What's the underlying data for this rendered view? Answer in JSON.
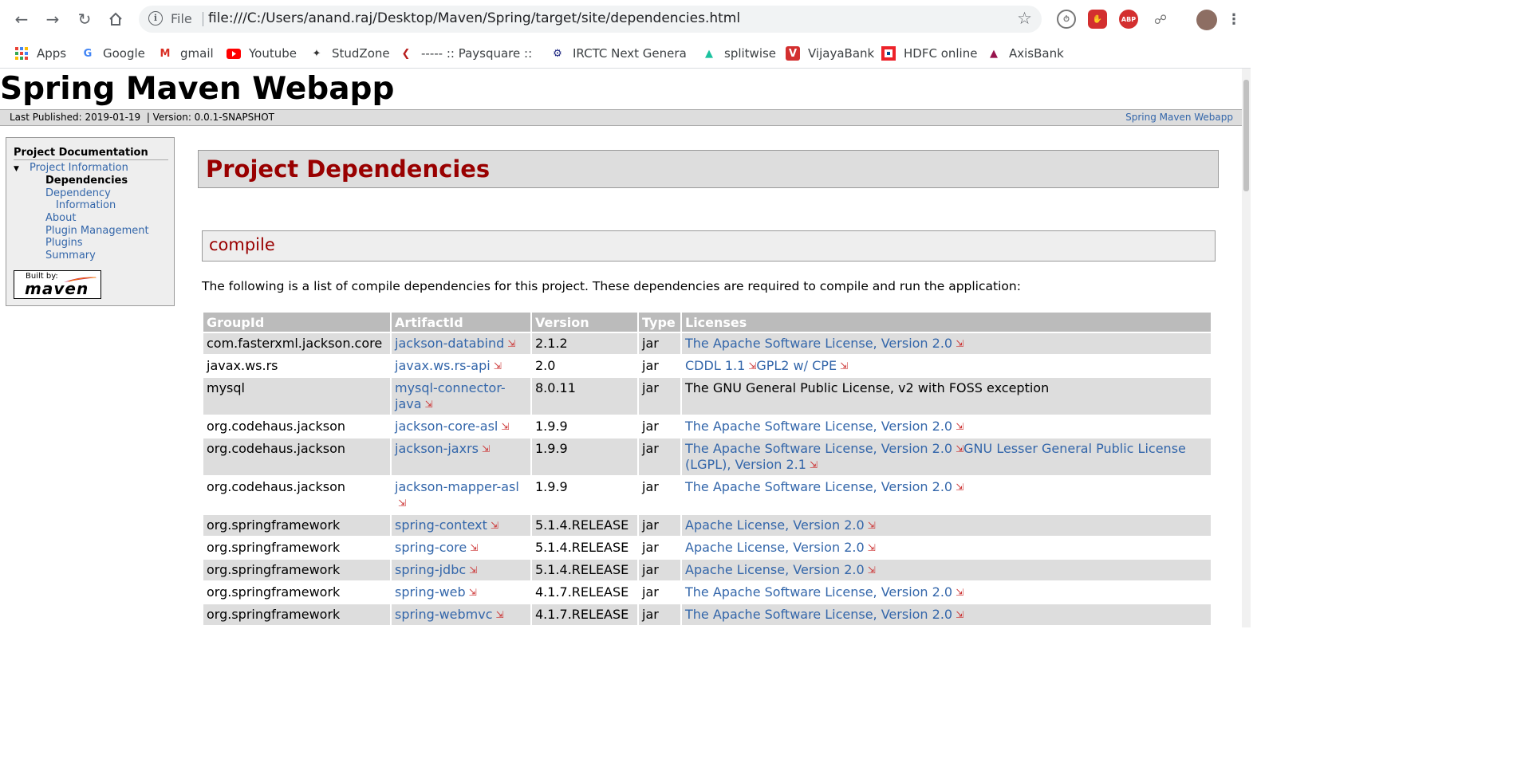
{
  "browser": {
    "url_scheme": "File",
    "url": "file:///C:/Users/anand.raj/Desktop/Maven/Spring/target/site/dependencies.html",
    "bookmarks": [
      {
        "label": "Apps",
        "icon": "apps-grid-icon",
        "color": "#ea4335"
      },
      {
        "label": "Google",
        "icon": "google-icon",
        "color": "#4285f4"
      },
      {
        "label": "gmail",
        "icon": "gmail-icon",
        "color": "#d93025"
      },
      {
        "label": "Youtube",
        "icon": "youtube-icon",
        "color": "#ff0000"
      },
      {
        "label": "StudZone",
        "icon": "studzone-icon",
        "color": "#333333"
      },
      {
        "label": "----- :: Paysquare :: --",
        "icon": "paysquare-icon",
        "color": "#b71c1c"
      },
      {
        "label": "IRCTC Next Generatio",
        "icon": "irctc-icon",
        "color": "#1a237e"
      },
      {
        "label": "splitwise",
        "icon": "splitwise-icon",
        "color": "#1cc29f"
      },
      {
        "label": "VijayaBank",
        "icon": "vijayabank-icon",
        "color": "#d32f2f"
      },
      {
        "label": "HDFC online",
        "icon": "hdfc-icon",
        "color": "#004c8f"
      },
      {
        "label": "AxisBank",
        "icon": "axisbank-icon",
        "color": "#97144d"
      }
    ]
  },
  "site": {
    "title": "Spring Maven Webapp",
    "last_published": "Last Published: 2019-01-19",
    "version": "| Version: 0.0.1-SNAPSHOT",
    "right_link": "Spring Maven Webapp"
  },
  "nav": {
    "header": "Project Documentation",
    "section": "Project Information",
    "current": "Dependencies",
    "items": [
      "Dependency",
      "Information",
      "About",
      "Plugin Management",
      "Plugins",
      "Summary"
    ],
    "built_by_small": "Built by:",
    "built_by_big": "maven"
  },
  "main": {
    "title": "Project Dependencies",
    "scope": "compile",
    "description": "The following is a list of compile dependencies for this project. These dependencies are required to compile and run the application:",
    "columns": [
      "GroupId",
      "ArtifactId",
      "Version",
      "Type",
      "Licenses"
    ],
    "rows": [
      {
        "group": "com.fasterxml.jackson.core",
        "artifact": "jackson-databind",
        "version": "2.1.2",
        "type": "jar",
        "licenses": [
          {
            "text": "The Apache Software License, Version 2.0",
            "link": true
          }
        ]
      },
      {
        "group": "javax.ws.rs",
        "artifact": "javax.ws.rs-api",
        "version": "2.0",
        "type": "jar",
        "licenses": [
          {
            "text": "CDDL 1.1",
            "link": true
          },
          {
            "text": "GPL2 w/ CPE",
            "link": true
          }
        ]
      },
      {
        "group": "mysql",
        "artifact": "mysql-connector-java",
        "version": "8.0.11",
        "type": "jar",
        "licenses": [
          {
            "text": "The GNU General Public License, v2 with FOSS exception",
            "link": false
          }
        ]
      },
      {
        "group": "org.codehaus.jackson",
        "artifact": "jackson-core-asl",
        "version": "1.9.9",
        "type": "jar",
        "licenses": [
          {
            "text": "The Apache Software License, Version 2.0",
            "link": true
          }
        ]
      },
      {
        "group": "org.codehaus.jackson",
        "artifact": "jackson-jaxrs",
        "version": "1.9.9",
        "type": "jar",
        "licenses": [
          {
            "text": "The Apache Software License, Version 2.0",
            "link": true
          },
          {
            "text": "GNU Lesser General Public License (LGPL), Version 2.1",
            "link": true
          }
        ]
      },
      {
        "group": "org.codehaus.jackson",
        "artifact": "jackson-mapper-asl",
        "version": "1.9.9",
        "type": "jar",
        "licenses": [
          {
            "text": "The Apache Software License, Version 2.0",
            "link": true
          }
        ]
      },
      {
        "group": "org.springframework",
        "artifact": "spring-context",
        "version": "5.1.4.RELEASE",
        "type": "jar",
        "licenses": [
          {
            "text": "Apache License, Version 2.0",
            "link": true
          }
        ]
      },
      {
        "group": "org.springframework",
        "artifact": "spring-core",
        "version": "5.1.4.RELEASE",
        "type": "jar",
        "licenses": [
          {
            "text": "Apache License, Version 2.0",
            "link": true
          }
        ]
      },
      {
        "group": "org.springframework",
        "artifact": "spring-jdbc",
        "version": "5.1.4.RELEASE",
        "type": "jar",
        "licenses": [
          {
            "text": "Apache License, Version 2.0",
            "link": true
          }
        ]
      },
      {
        "group": "org.springframework",
        "artifact": "spring-web",
        "version": "4.1.7.RELEASE",
        "type": "jar",
        "licenses": [
          {
            "text": "The Apache Software License, Version 2.0",
            "link": true
          }
        ]
      },
      {
        "group": "org.springframework",
        "artifact": "spring-webmvc",
        "version": "4.1.7.RELEASE",
        "type": "jar",
        "licenses": [
          {
            "text": "The Apache Software License, Version 2.0",
            "link": true
          }
        ]
      }
    ]
  }
}
